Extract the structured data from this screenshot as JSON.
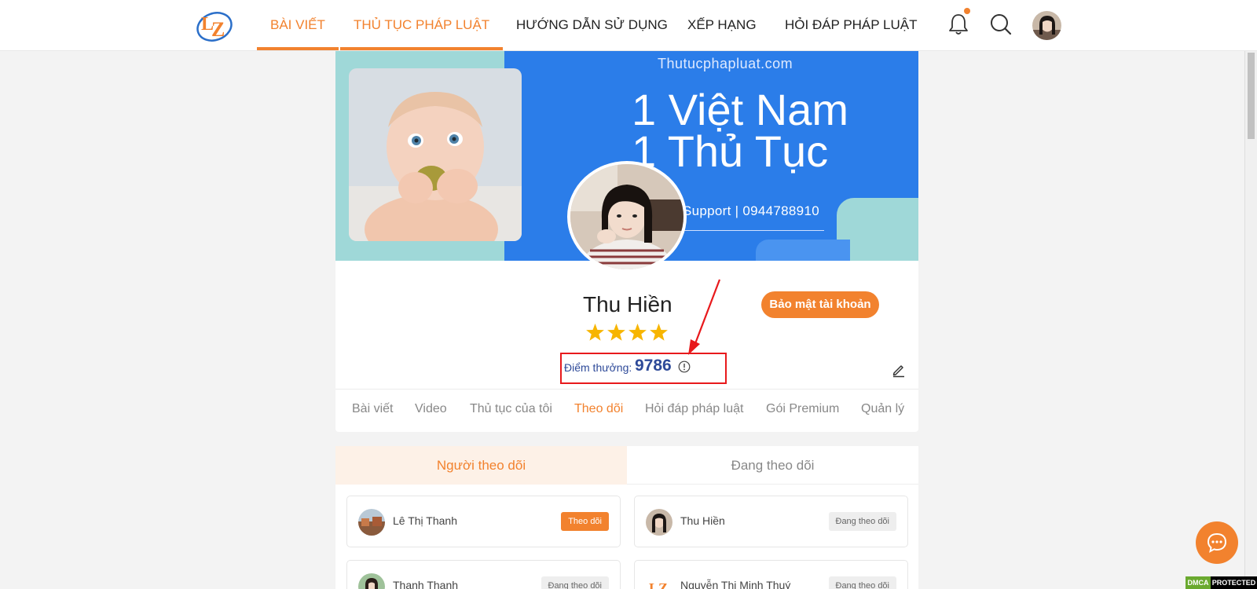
{
  "nav": {
    "items": [
      "BÀI VIẾT",
      "THỦ TỤC PHÁP LUẬT",
      "HƯỚNG DẪN SỬ DỤNG",
      "XẾP HẠNG",
      "HỎI ĐÁP PHÁP LUẬT"
    ],
    "active": [
      "BÀI VIẾT",
      "THỦ TỤC PHÁP LUẬT"
    ]
  },
  "header_icons": [
    "bell-icon",
    "search-icon"
  ],
  "banner": {
    "site": "Thutucphapluat.com",
    "line1": "1 Việt Nam",
    "line2": "1 Thủ Tục",
    "support": "Support | 0944788910"
  },
  "profile": {
    "name": "Thu Hiền",
    "stars": 4,
    "security_button": "Bảo mật tài khoản",
    "points_label": "Điểm thưởng:",
    "points_value": "9786"
  },
  "tabs": [
    "Bài viết",
    "Video",
    "Thủ tục của tôi",
    "Theo dõi",
    "Hỏi đáp pháp luật",
    "Gói Premium",
    "Quản lý"
  ],
  "active_tab": "Theo dõi",
  "follow_tabs": [
    "Người theo dõi",
    "Đang theo dõi"
  ],
  "followers": [
    {
      "name": "Lê Thị Thanh",
      "button": "Theo dõi"
    },
    {
      "name": "Thu Hiền",
      "button": "Đang theo dõi"
    },
    {
      "name": "Thanh Thanh",
      "button": "Đang theo dõi"
    },
    {
      "name": "Nguyễn Thị Minh Thuý",
      "button": "Đang theo dõi"
    }
  ],
  "dmca": {
    "left": "DMCA",
    "right": "PROTECTED"
  },
  "colors": {
    "accent": "#f2822e",
    "banner_blue": "#2b7de9",
    "banner_teal": "#9fd8d8",
    "points": "#2e4a99",
    "highlight": "#e8191c",
    "star": "#f7b500"
  }
}
